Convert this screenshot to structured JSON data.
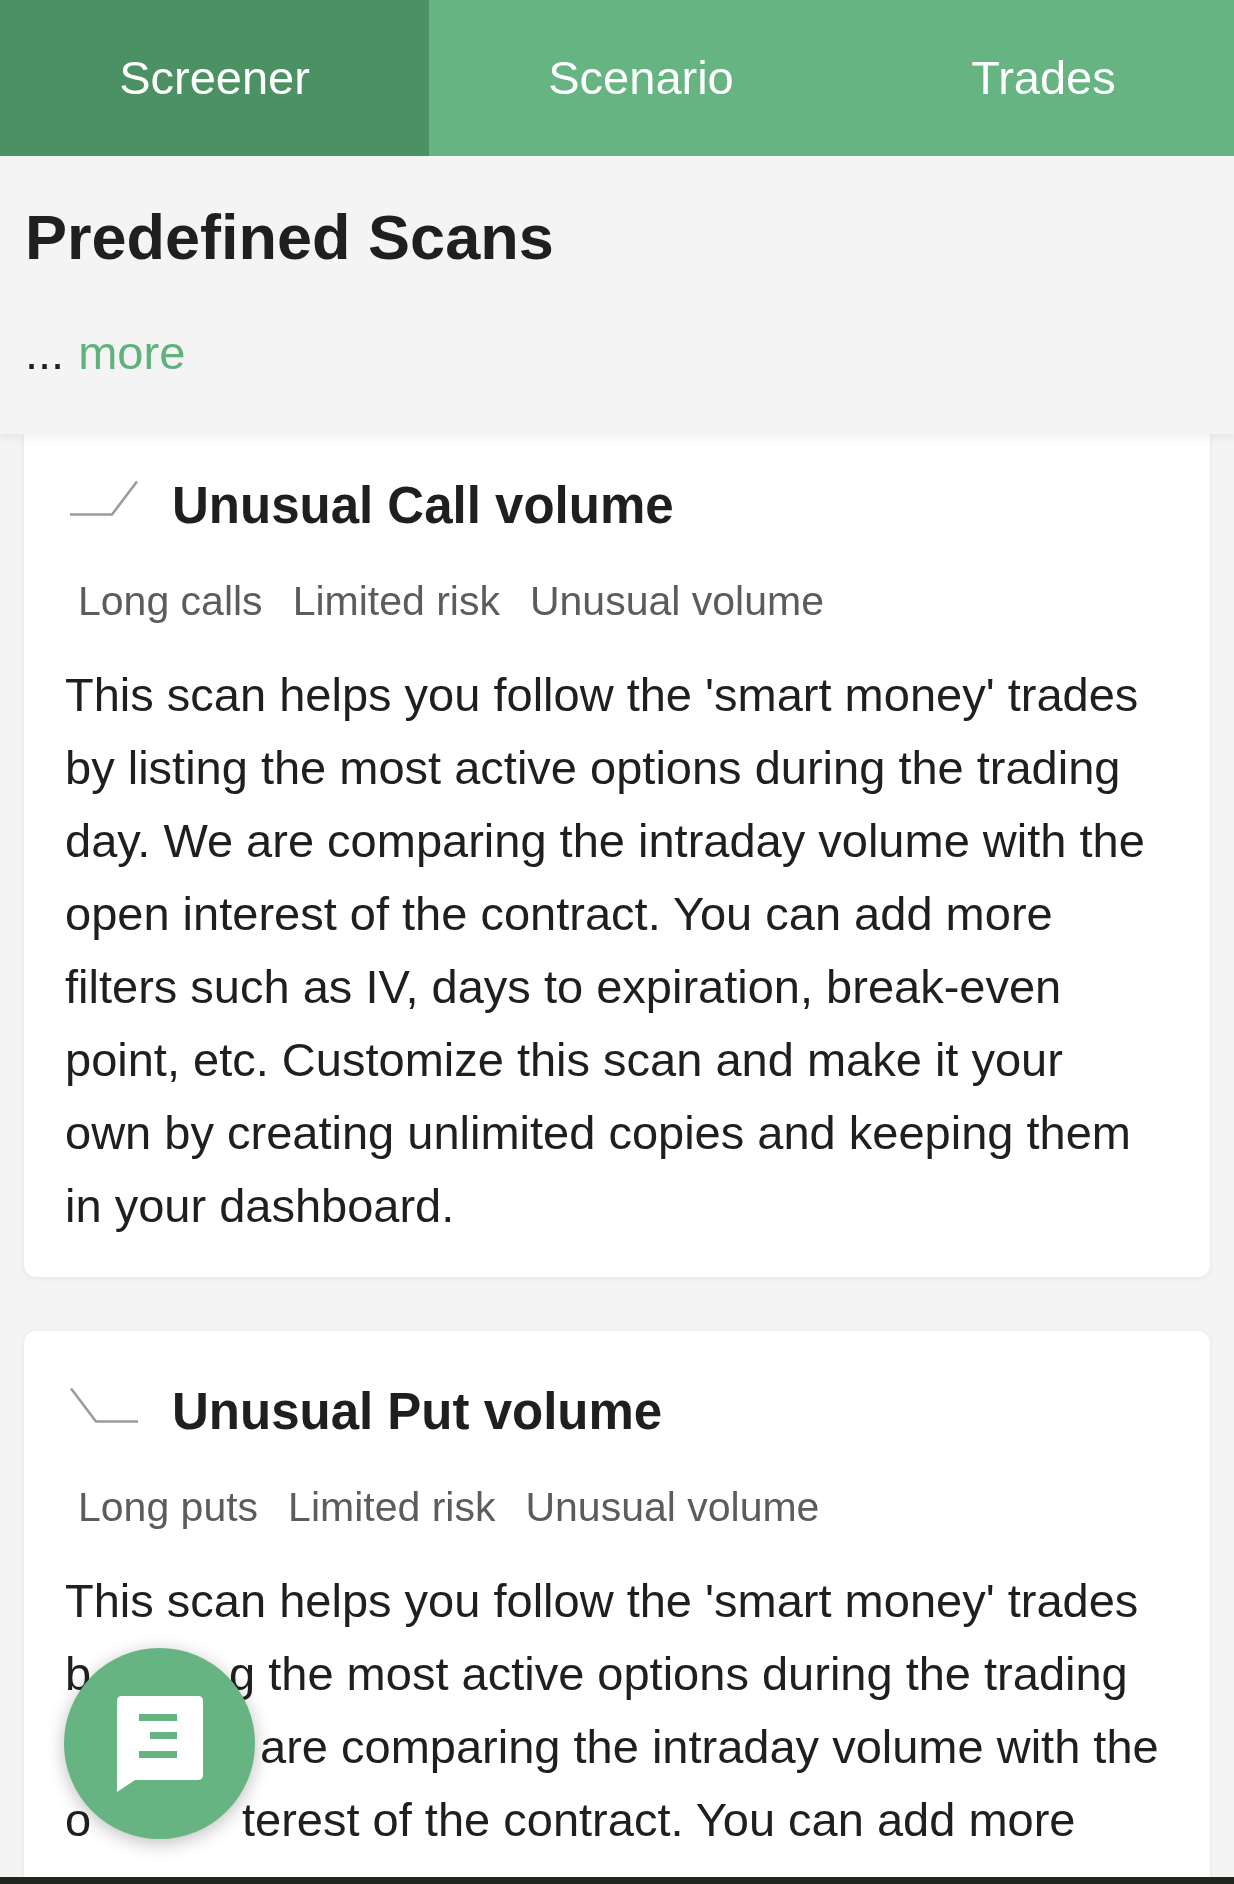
{
  "tabs": [
    {
      "label": "Screener",
      "selected": true
    },
    {
      "label": "Scenario",
      "selected": false
    },
    {
      "label": "Trades",
      "selected": false
    }
  ],
  "header": {
    "title": "Predefined Scans",
    "ellipsis": "...",
    "more_link": "more"
  },
  "scans": [
    {
      "kind": "rising",
      "title": "Unusual Call volume",
      "tags": [
        "Long calls",
        "Limited risk",
        "Unusual volume"
      ],
      "description": "This scan helps you follow the 'smart money' trades by listing the most active options during the trading day. We are comparing the intraday volume with the open interest of the contract. You can add more filters such as IV, days to expiration, break-even point, etc. Customize this scan and make it your own by creating unlimited copies and keeping them in your dashboard."
    },
    {
      "kind": "falling",
      "title": "Unusual Put volume",
      "tags": [
        "Long puts",
        "Limited risk",
        "Unusual volume"
      ],
      "description_lines": [
        {
          "left": "This scan helps you follow the 'smart money' trades"
        },
        {
          "left": "b",
          "right": "g the most active options during the trading"
        },
        {
          "right": "are comparing the intraday volume with the"
        },
        {
          "left": "o",
          "right": "terest of the contract. You can add more"
        }
      ]
    }
  ]
}
